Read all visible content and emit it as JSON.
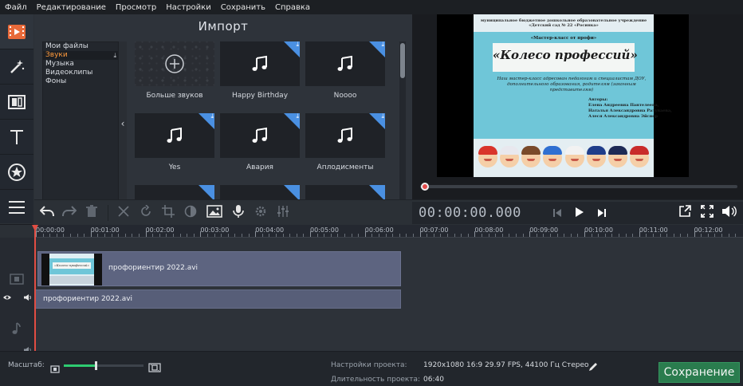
{
  "menu": [
    "Файл",
    "Редактирование",
    "Просмотр",
    "Настройки",
    "Сохранить",
    "Справка"
  ],
  "rail": [
    {
      "icon": "film-play-icon",
      "active": true
    },
    {
      "icon": "magic-wand-icon"
    },
    {
      "icon": "transition-icon"
    },
    {
      "icon": "text-icon"
    },
    {
      "icon": "sticker-star-icon"
    },
    {
      "icon": "more-menu-icon"
    }
  ],
  "import": {
    "title": "Импорт",
    "categories": [
      {
        "label": "Мои файлы"
      },
      {
        "label": "Звуки",
        "selected": true
      },
      {
        "label": "Музыка"
      },
      {
        "label": "Видеоклипы"
      },
      {
        "label": "Фоны"
      }
    ],
    "collapse_glyph": "‹",
    "download_glyph": "⤓",
    "tiles": [
      {
        "label": "Больше звуков",
        "kind": "more"
      },
      {
        "label": "Happy Birthday",
        "kind": "sound"
      },
      {
        "label": "Noooo",
        "kind": "sound"
      },
      {
        "label": "Yes",
        "kind": "sound"
      },
      {
        "label": "Авария",
        "kind": "sound"
      },
      {
        "label": "Аплодисменты",
        "kind": "sound"
      }
    ]
  },
  "preview": {
    "slide": {
      "header": "муниципальное бюджетное дошкольное образовательное учреждение «Детский сад № 22 «Росинка»",
      "subtitle": "«Мастер-класс от профи»",
      "title": "«Колесо профессий»",
      "description": "Наш мастер-класс адресован педагогам и специалистам ДОУ, дополнительного образования, родителям (законным представителям)",
      "authors": [
        "Авторы:",
        "Елена Андреевна Пантелеева,",
        "Наталья Александровна Разуваева,",
        "Алеся Александровна Эйснер"
      ]
    },
    "kid_hats": [
      "#d9342b",
      "#e8e8ee",
      "#7a4a2a",
      "#2f6fd1",
      "#f2f2f2",
      "#1f3d8a",
      "#1e2a55",
      "#c92b2b"
    ]
  },
  "toolbar": {
    "timecode": "00:00:00.000"
  },
  "timeline": {
    "ticks": [
      "00:00:00",
      "00:01:00",
      "00:02:00",
      "00:03:00",
      "00:04:00",
      "00:05:00",
      "00:06:00",
      "00:07:00",
      "00:08:00",
      "00:09:00",
      "00:10:00",
      "00:11:00",
      "00:12:00"
    ],
    "video_clip": "профориентир 2022.avi",
    "audio_clip": "профориентир 2022.avi",
    "thumb_title": "«Колесо профессий»"
  },
  "status": {
    "zoom_label": "Масштаб:",
    "zoom_level": 0.4,
    "settings_label": "Настройки проекта:",
    "settings_value": "1920x1080 16:9 29.97 FPS, 44100 Гц Стерео",
    "duration_label": "Длительность проекта:",
    "duration_value": "06:40",
    "save_label": "Сохранение"
  },
  "colors": {
    "accent_green": "#2a7c4e",
    "selected_category": "#ff9a3c",
    "playhead": "#e14d43",
    "download_corner": "#4a90e2"
  }
}
